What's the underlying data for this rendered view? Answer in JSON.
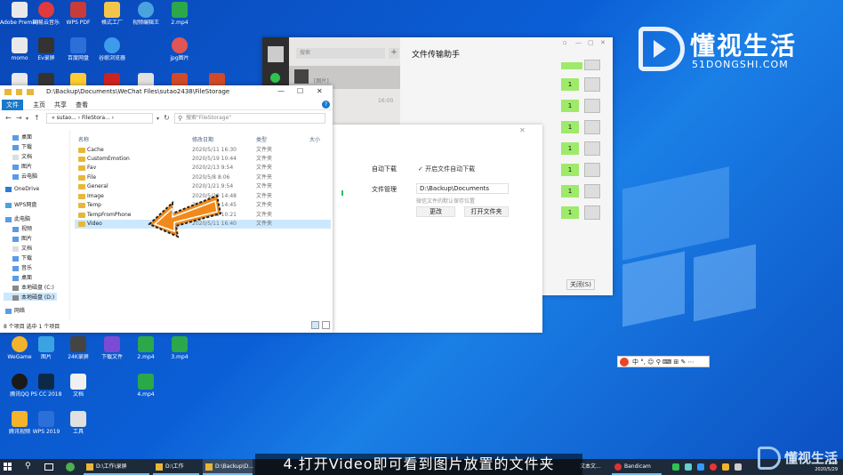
{
  "desktop": {
    "icons_row1": [
      "Adobe Premier...",
      "网易云音乐",
      "WPS PDF",
      "格式工厂",
      "视频编辑王",
      "2.mp4"
    ],
    "icons_row2": [
      "momo",
      "Ev录屏",
      "百度网盘",
      "谷歌浏览器",
      "",
      "jpg图片"
    ],
    "icons_row3": [
      "",
      "",
      "",
      "",
      "",
      "PPT"
    ],
    "icons_bottom1": [
      "WeGame",
      "图片",
      "24K录屏",
      "下载文件",
      "2.mp4",
      "3.mp4"
    ],
    "icons_bottom2": [
      "腾讯QQ",
      "PS CC 2018",
      "文档",
      "",
      "4.mp4",
      ""
    ],
    "icons_bottom3": [
      "腾讯视频",
      "WPS 2019",
      "工具",
      "",
      "",
      ""
    ]
  },
  "logo": {
    "title": "懂视生活",
    "sub": "51DONGSHI.COM"
  },
  "wechat": {
    "search_placeholder": "搜索",
    "plus": "+",
    "chat_title": "文件传输助手",
    "controls": [
      "▫",
      "—",
      "▢",
      "✕"
    ],
    "messages": [
      "1",
      "1",
      "1",
      "1",
      "1",
      "1",
      "1"
    ],
    "contact_hint": "[图片]",
    "contact_time": "16:00"
  },
  "settings": {
    "close": "✕",
    "auto_download_label": "自动下载",
    "auto_download_check": "✓  开启文件自动下载",
    "file_manage_label": "文件管理",
    "path_value": "D:\\Backup\\Documents",
    "path_hint": "微信文件的默认保存位置",
    "change_btn": "更改",
    "open_folder_btn": "打开文件夹",
    "cancel_btn": "关闭(S)"
  },
  "explorer": {
    "title_path": "D:\\Backup\\Documents\\WeChat Files\\sutao2438\\FileStorage",
    "win_min": "—",
    "win_max": "☐",
    "win_close": "✕",
    "tabs": [
      "文件",
      "主页",
      "共享",
      "查看"
    ],
    "help": "?",
    "address": "« sutao... › FileStora... ›",
    "search_placeholder": "搜索\"FileStorage\"",
    "col_name": "名称",
    "col_date": "修改日期",
    "col_type": "类型",
    "col_size": "大小",
    "tree": [
      {
        "label": "桌面"
      },
      {
        "label": "下载"
      },
      {
        "label": "文档"
      },
      {
        "label": "图片"
      },
      {
        "label": "云电脑"
      },
      {
        "label": "OneDrive"
      },
      {
        "label": "WPS网盘"
      },
      {
        "label": "此电脑"
      },
      {
        "label": "视频"
      },
      {
        "label": "图片"
      },
      {
        "label": "文档"
      },
      {
        "label": "下载"
      },
      {
        "label": "音乐"
      },
      {
        "label": "桌面"
      },
      {
        "label": "本地磁盘 (C:)"
      },
      {
        "label": "本地磁盘 (D:)"
      },
      {
        "label": "网络"
      }
    ],
    "rows": [
      {
        "name": "Cache",
        "date": "2020/5/11 16:30",
        "type": "文件夹"
      },
      {
        "name": "CustomEmotion",
        "date": "2020/5/19 10:44",
        "type": "文件夹"
      },
      {
        "name": "Fav",
        "date": "2020/2/13 9:54",
        "type": "文件夹"
      },
      {
        "name": "File",
        "date": "2020/5/8 8:06",
        "type": "文件夹"
      },
      {
        "name": "General",
        "date": "2020/1/21 9:54",
        "type": "文件夹"
      },
      {
        "name": "Image",
        "date": "2020/5/29 14:48",
        "type": "文件夹"
      },
      {
        "name": "Temp",
        "date": "2020/5/29 14:45",
        "type": "文件夹"
      },
      {
        "name": "TempFromPhone",
        "date": "2020/5/29 10:21",
        "type": "文件夹"
      },
      {
        "name": "Video",
        "date": "2020/5/11 16:40",
        "type": "文件夹"
      }
    ],
    "status": "8 个项目    选中 1 个项目"
  },
  "ime": {
    "text": "中 °, ☺ ⚲ ⌨ ⊞ ✎ ⋯"
  },
  "caption": "4.打开Video即可看到图片放置的文件夹",
  "taskbar": {
    "items": [
      "D:\\工作\\录屏",
      "D:\\工作",
      "D:\\Backup\\D...",
      "Bandicam"
    ],
    "tail_label": "文本文...",
    "time": "17:30",
    "date": "2020/5/29"
  },
  "watermark": "懂视生活",
  "colors": {
    "accent": "#1979ca",
    "wechat_bubble": "#9eea6a",
    "desktop": "#0b5fd6",
    "arrow": "#f08a1c"
  }
}
